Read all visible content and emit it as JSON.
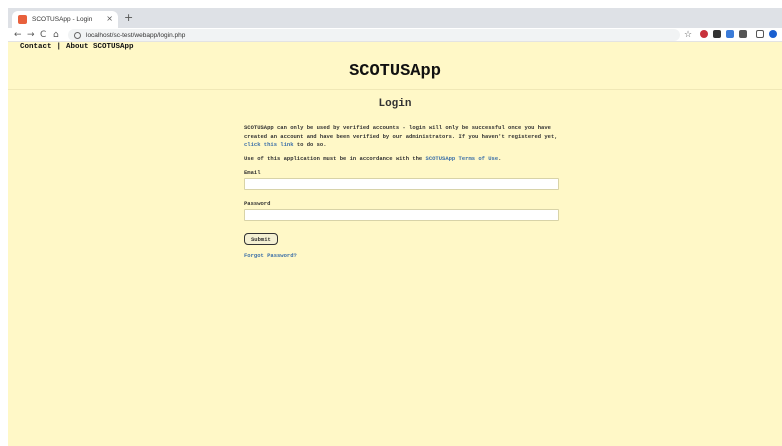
{
  "browser": {
    "tab_title": "SCOTUSApp - Login",
    "tab_close": "×",
    "new_tab": "+",
    "nav": {
      "back": "←",
      "forward": "→",
      "reload": "C",
      "home": "⌂"
    },
    "url": "localhost/sc-test/webapp/login.php",
    "bookmark": "☆"
  },
  "topnav": {
    "contact": "Contact",
    "separator": "|",
    "about": "About SCOTUSApp"
  },
  "app_title": "SCOTUSApp",
  "login": {
    "heading": "Login",
    "intro_pre": "SCOTUSApp can only be used by verified accounts - login will only be successful once you have created an account and have been verified by our administrators. If you haven't registered yet, ",
    "intro_link": "click this link",
    "intro_post": " to do so.",
    "terms_pre": "Use of this application must be in accordance with the ",
    "terms_link": "SCOTUSApp Terms of Use",
    "terms_post": ".",
    "email_label": "Email",
    "password_label": "Password",
    "submit_label": "Submit",
    "forgot_label": "Forgot Password?"
  },
  "colors": {
    "page_bg": "#fff8c7",
    "link": "#3a6ea8",
    "favicon": "#e8603c"
  }
}
